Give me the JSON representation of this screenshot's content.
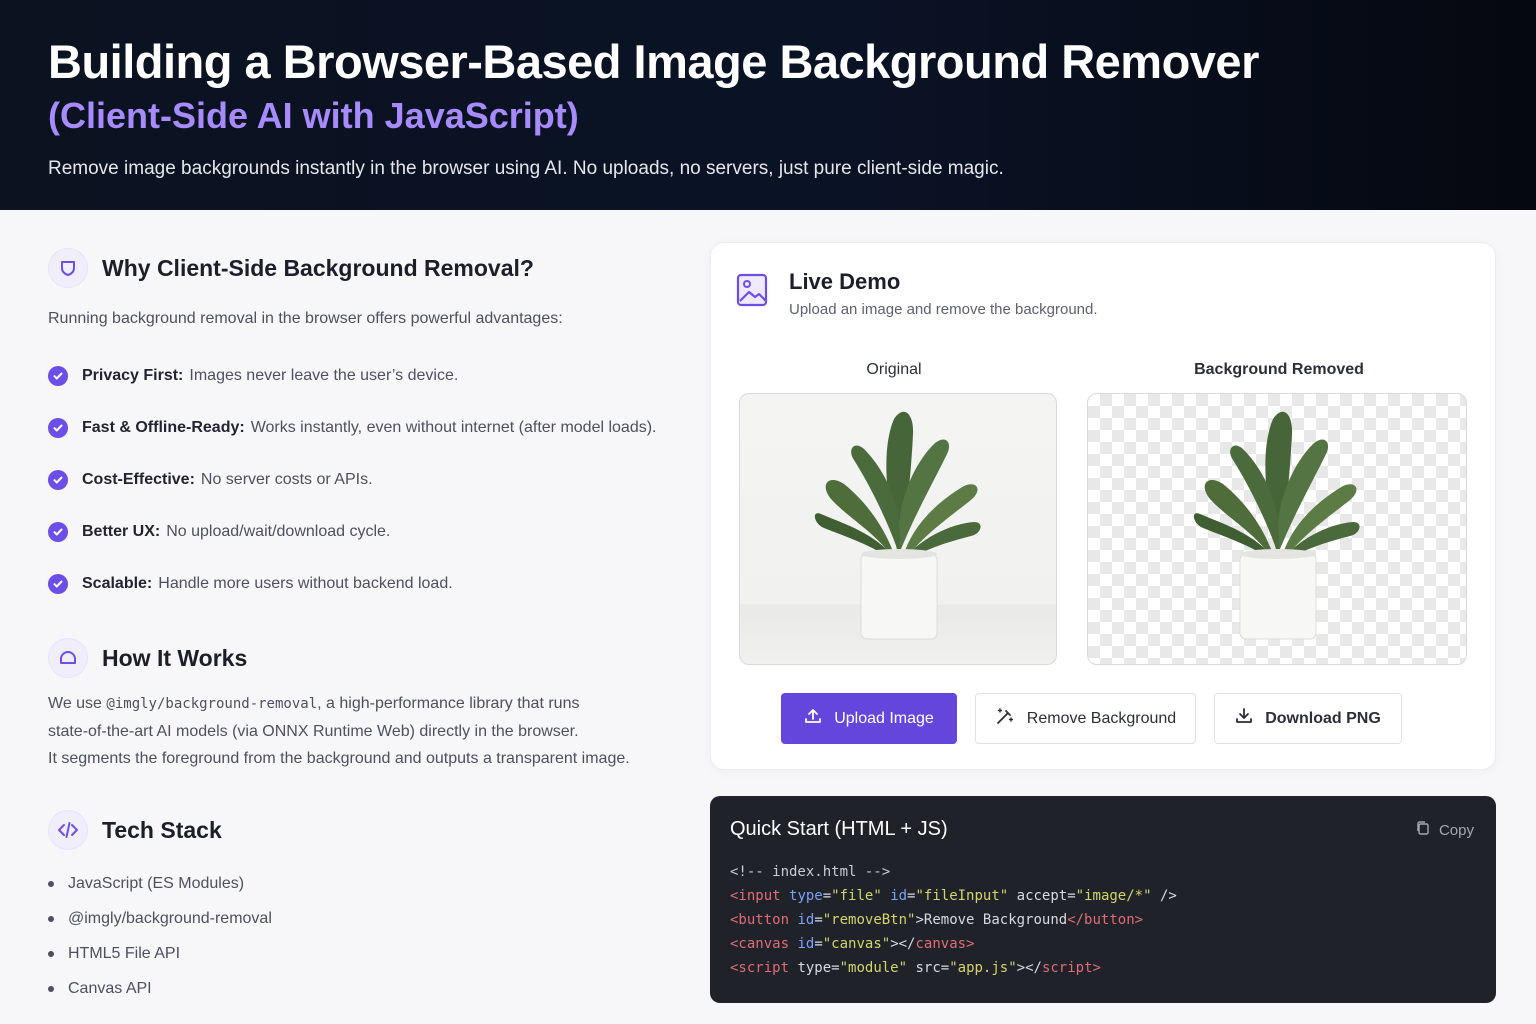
{
  "hero": {
    "title": "Building a Browser-Based Image Background Remover",
    "subtitle": "(Client-Side AI with JavaScript)",
    "tagline": "Remove image backgrounds instantly in the browser using AI. No uploads, no servers, just pure client-side magic."
  },
  "why": {
    "heading": "Why Client-Side Background Removal?",
    "lead": "Running background removal in the browser offers powerful advantages:",
    "icon": "shield-icon",
    "items": [
      {
        "title": "Privacy First:",
        "text": "Images never leave the user’s device."
      },
      {
        "title": "Fast & Offline-Ready:",
        "text": "Works instantly, even without internet (after model loads)."
      },
      {
        "title": "Cost-Effective:",
        "text": "No server costs or APIs."
      },
      {
        "title": "Better UX:",
        "text": "No upload/wait/download cycle."
      },
      {
        "title": "Scalable:",
        "text": "Handle more users without backend load."
      }
    ]
  },
  "how": {
    "heading": "How It Works",
    "icon": "dome-icon",
    "line1_pre": "We use ",
    "library": "@imgly/background-removal",
    "line1_post": ", a high-performance library that runs",
    "line2": "state-of-the-art AI models (via ONNX Runtime Web) directly in the browser.",
    "line3": "It segments the foreground from the background and outputs a transparent image."
  },
  "tech": {
    "heading": "Tech Stack",
    "icon": "code-icon",
    "items": [
      "JavaScript (ES Modules)",
      "@imgly/background-removal",
      "HTML5 File API",
      "Canvas API"
    ]
  },
  "demo": {
    "title": "Live Demo",
    "subtitle": "Upload an image and remove the background.",
    "original_label": "Original",
    "removed_label": "Background Removed",
    "upload_label": "Upload Image",
    "remove_label": "Remove Background",
    "download_label": "Download PNG",
    "accent": "#6546dc"
  },
  "code": {
    "title": "Quick Start (HTML + JS)",
    "copy_label": "Copy",
    "comment": "<!-- index.html -->",
    "l2": {
      "open": "<input",
      "a1": "type",
      "v1": "\"file\"",
      "a2": "id",
      "v2": "\"fileInput\"",
      "a3": "accept",
      "v3": "\"image/*\"",
      "close": "/>"
    },
    "l3": {
      "open": "<button",
      "a1": "id",
      "v1": "\"removeBtn\"",
      "gt": ">",
      "text": "Remove Background",
      "end": "</button>"
    },
    "l4": {
      "open": "<canvas",
      "a1": "id",
      "v1": "\"canvas\"",
      "gt": "></",
      "end": "canvas>"
    },
    "l5": {
      "open": "<script",
      "a1": "type",
      "v1": "\"module\"",
      "a2": "src",
      "v2": "\"app.js\"",
      "gt": "></",
      "end": "script>"
    }
  }
}
